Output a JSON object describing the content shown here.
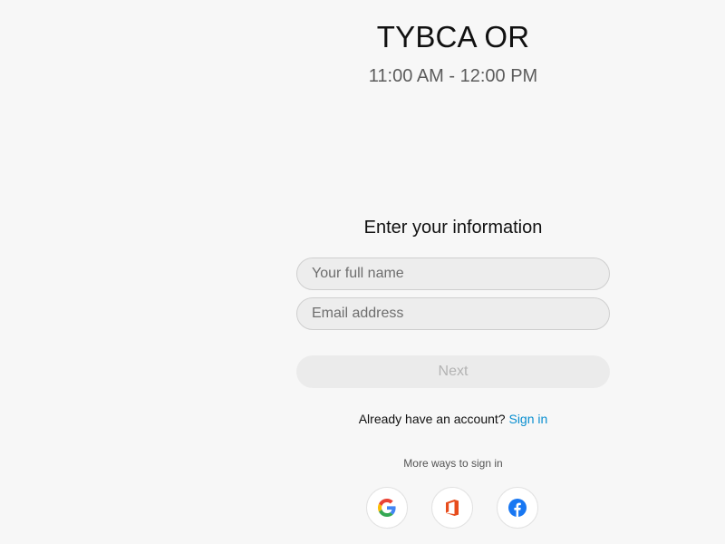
{
  "meeting": {
    "title": "TYBCA OR",
    "time": "11:00 AM - 12:00 PM"
  },
  "form": {
    "heading": "Enter your information",
    "name_placeholder": "Your full name",
    "email_placeholder": "Email address",
    "next_label": "Next"
  },
  "account": {
    "prompt": "Already have an account?",
    "sign_in_label": "Sign in"
  },
  "more_ways": {
    "label": "More ways to sign in",
    "providers": [
      "google-icon",
      "microsoft-office-icon",
      "facebook-icon"
    ]
  },
  "colors": {
    "background": "#f7f7f7",
    "link": "#0a8fd0",
    "disabled_button_text": "#b3b3b3",
    "office_orange": "#e74c1c",
    "facebook_blue": "#1877f2"
  }
}
